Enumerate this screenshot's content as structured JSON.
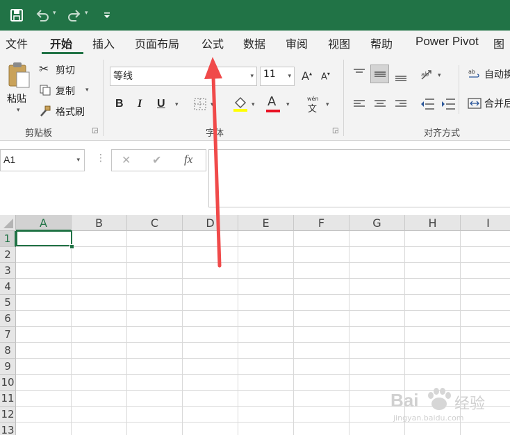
{
  "quick_access": {
    "save_icon": "save-icon",
    "undo_icon": "undo-icon",
    "redo_icon": "redo-icon",
    "customize_icon": "customize-quick-access-icon"
  },
  "tabs": [
    "文件",
    "开始",
    "插入",
    "页面布局",
    "公式",
    "数据",
    "审阅",
    "视图",
    "帮助",
    "Power Pivot",
    "图"
  ],
  "active_tab": "开始",
  "clipboard": {
    "paste_label": "粘贴",
    "cut_label": "剪切",
    "copy_label": "复制",
    "format_painter_label": "格式刷",
    "group_label": "剪贴板"
  },
  "font": {
    "font_name": "等线",
    "font_size": "11",
    "bold": "B",
    "italic": "I",
    "underline": "U",
    "font_color_letter": "A",
    "grow_label": "A",
    "shrink_label": "A",
    "phonetic_label": "wén",
    "phonetic_char": "文",
    "group_label": "字体"
  },
  "alignment": {
    "wrap_text_label": "自动换",
    "merge_label": "合并后",
    "group_label": "对齐方式"
  },
  "colors": {
    "title_bar": "#217346",
    "fill_highlight": "#ffff00",
    "font_red": "#e81123",
    "arrow": "#f04a4a"
  },
  "formula_bar": {
    "name_box": "A1",
    "cancel_icon": "✕",
    "enter_icon": "✔",
    "fx_label": "fx",
    "formula": ""
  },
  "grid": {
    "columns": [
      "A",
      "B",
      "C",
      "D",
      "E",
      "F",
      "G",
      "H",
      "I"
    ],
    "rows": [
      "1",
      "2",
      "3",
      "4",
      "5",
      "6",
      "7",
      "8",
      "9",
      "10",
      "11",
      "12",
      "13"
    ],
    "selected_cell": "A1"
  },
  "watermark": {
    "brand": "Bai",
    "brand2": "经验",
    "url": "jingyan.baidu.com"
  }
}
